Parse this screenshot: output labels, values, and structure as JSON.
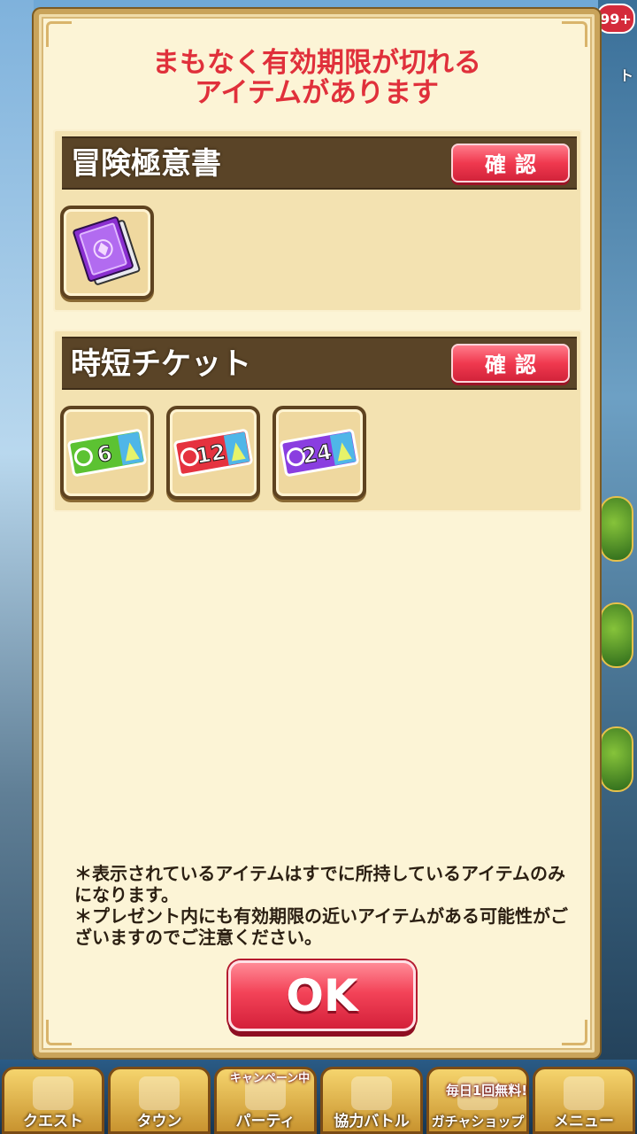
{
  "background": {
    "notification_badge": "99+",
    "side_label": "ト",
    "banners": [
      "キャンペーン中",
      "毎日1回無料!"
    ]
  },
  "bottom_nav": {
    "items": [
      {
        "label": "クエスト",
        "icon": "quest-icon"
      },
      {
        "label": "タウン",
        "icon": "town-icon"
      },
      {
        "label": "パーティ",
        "icon": "party-icon"
      },
      {
        "label": "協力バトル",
        "icon": "coop-battle-icon"
      },
      {
        "label": "ガチャショップ",
        "icon": "gacha-shop-icon"
      },
      {
        "label": "メニュー",
        "icon": "menu-icon"
      }
    ]
  },
  "dialog": {
    "title_line1": "まもなく有効期限が切れる",
    "title_line2": "アイテムがあります",
    "sections": [
      {
        "title": "冒険極意書",
        "confirm_label": "確認",
        "items": [
          {
            "icon": "purple-book-icon"
          }
        ]
      },
      {
        "title": "時短チケット",
        "confirm_label": "確認",
        "items": [
          {
            "icon": "time-ticket-icon",
            "number": "6",
            "color": "#5cc232"
          },
          {
            "icon": "time-ticket-icon",
            "number": "12",
            "color": "#e5323f"
          },
          {
            "icon": "time-ticket-icon",
            "number": "24",
            "color": "#8a3ee0"
          }
        ]
      }
    ],
    "note1": "＊表示されているアイテムはすでに所持しているアイテムのみになります。",
    "note2": "＊プレゼント内にも有効期限の近いアイテムがある可能性がございますのでご注意ください。",
    "ok_label": "OK"
  }
}
